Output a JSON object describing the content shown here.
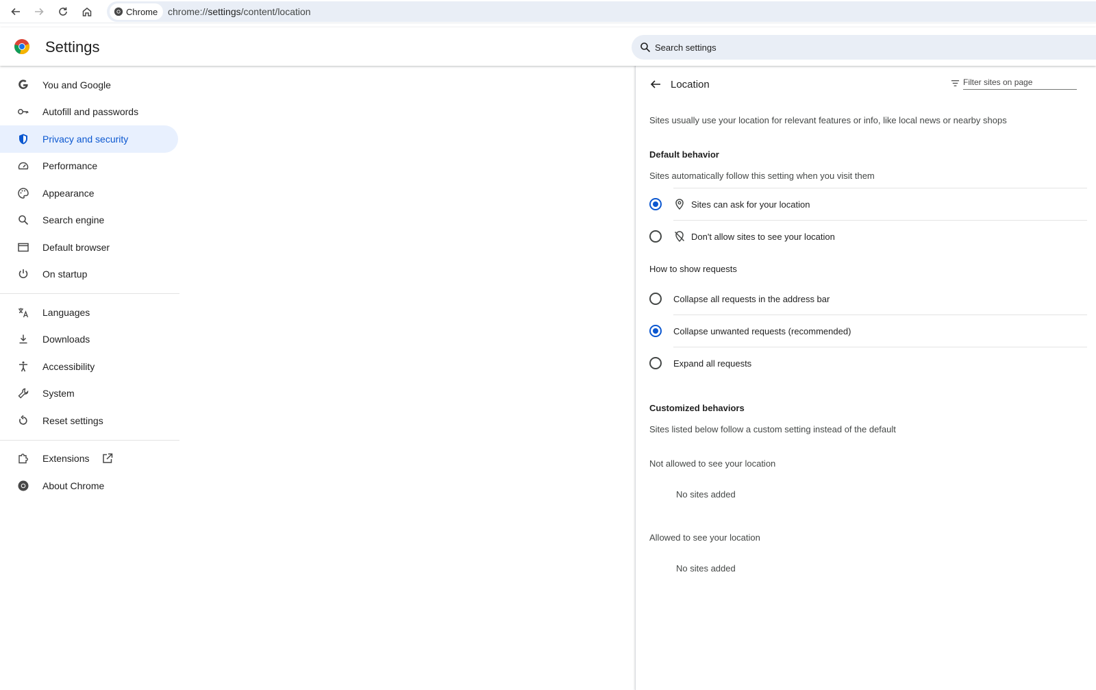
{
  "browser": {
    "chip_label": "Chrome",
    "url_prefix": "chrome://",
    "url_host": "settings",
    "url_path": "/content/location"
  },
  "header": {
    "title": "Settings",
    "search_placeholder": "Search settings"
  },
  "sidebar": {
    "items": [
      {
        "label": "You and Google",
        "icon": "google-g-icon"
      },
      {
        "label": "Autofill and passwords",
        "icon": "key-icon"
      },
      {
        "label": "Privacy and security",
        "icon": "shield-icon",
        "active": true
      },
      {
        "label": "Performance",
        "icon": "speedometer-icon"
      },
      {
        "label": "Appearance",
        "icon": "palette-icon"
      },
      {
        "label": "Search engine",
        "icon": "search-icon"
      },
      {
        "label": "Default browser",
        "icon": "browser-window-icon"
      },
      {
        "label": "On startup",
        "icon": "power-icon"
      },
      {
        "label": "Languages",
        "icon": "translate-icon"
      },
      {
        "label": "Downloads",
        "icon": "download-icon"
      },
      {
        "label": "Accessibility",
        "icon": "accessibility-icon"
      },
      {
        "label": "System",
        "icon": "wrench-icon"
      },
      {
        "label": "Reset settings",
        "icon": "reset-icon"
      },
      {
        "label": "Extensions",
        "icon": "puzzle-icon"
      },
      {
        "label": "About Chrome",
        "icon": "chrome-icon"
      }
    ]
  },
  "location": {
    "title": "Location",
    "filter_placeholder": "Filter sites on page",
    "description": "Sites usually use your location for relevant features or info, like local news or nearby shops",
    "default_behavior": {
      "heading": "Default behavior",
      "subtitle": "Sites automatically follow this setting when you visit them",
      "options": [
        {
          "label": "Sites can ask for your location",
          "icon": "location-pin-icon",
          "selected": true
        },
        {
          "label": "Don't allow sites to see your location",
          "icon": "location-off-icon",
          "selected": false
        }
      ]
    },
    "requests": {
      "heading": "How to show requests",
      "options": [
        {
          "label": "Collapse all requests in the address bar",
          "selected": false
        },
        {
          "label": "Collapse unwanted requests (recommended)",
          "selected": true
        },
        {
          "label": "Expand all requests",
          "selected": false
        }
      ]
    },
    "customized": {
      "heading": "Customized behaviors",
      "subtitle": "Sites listed below follow a custom setting instead of the default",
      "not_allowed_heading": "Not allowed to see your location",
      "not_allowed_empty": "No sites added",
      "allowed_heading": "Allowed to see your location",
      "allowed_empty": "No sites added"
    }
  },
  "colors": {
    "accent": "#0b57d0",
    "active_bg": "#e8f0fe",
    "omnibox_bg": "#e9eef6"
  }
}
